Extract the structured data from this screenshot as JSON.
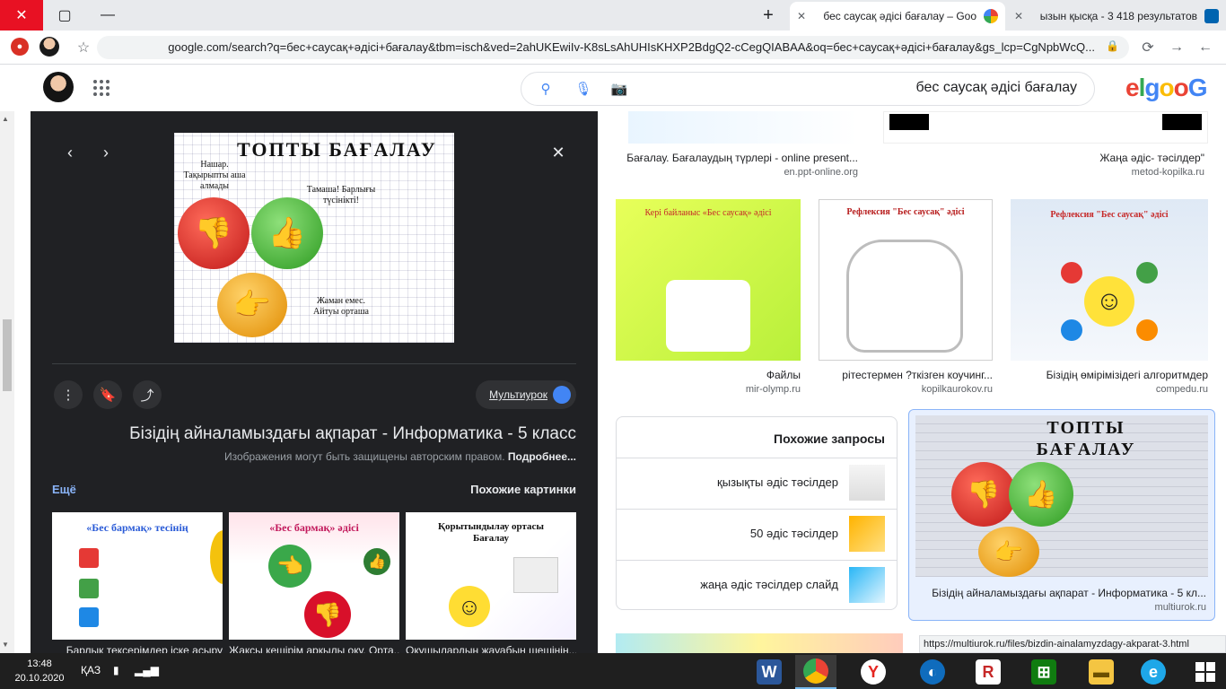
{
  "tabs": [
    {
      "title": "бес саусақ әдісі бағалау – Goo",
      "active": true
    },
    {
      "title": "ызын қысқа - 3 418 результатов",
      "active": false
    }
  ],
  "window_controls": {
    "close": "✕",
    "maximize": "▢",
    "minimize": "—"
  },
  "address_bar": {
    "url": "google.com/search?q=бес+саусақ+әдісі+бағалау&tbm=isch&ved=2ahUKEwiIv-K8sLsAhUHIsKHXP2BdgQ2-cCegQIABAA&oq=бес+саусақ+әдісі+бағалау&gs_lcp=CgNpbWcQ..."
  },
  "search": {
    "query": "бес саусақ әдісі бағалау"
  },
  "logo": {
    "letters": [
      "G",
      "o",
      "o",
      "g",
      "l",
      "e"
    ],
    "colors": [
      "#4285f4",
      "#ea4335",
      "#fbbc05",
      "#4285f4",
      "#34a853",
      "#ea4335"
    ]
  },
  "preview": {
    "image_title": "ТОПТЫ БАҒАЛАУ",
    "image_labels": {
      "top_left": "Нашар. Тақырыпты аша алмады",
      "middle": "Тамаша! Барлығы түсінікті!",
      "bottom": "Жаман емес. Айтуы орташа"
    },
    "source": "Мультиурок",
    "title": "Бізідің айналамыздағы ақпарат - Информатика - 5 класс",
    "copyright": "Изображения могут быть защищены авторским правом.",
    "copyright_link": "Подробнее...",
    "similar_label": "Похожие картинки",
    "more_label": "Ещё",
    "similar": [
      {
        "caption": "Оқушылардың жауабын шешінін...",
        "img_title": "Қорытындылау ортасы Бағалау"
      },
      {
        "caption": "Жақсы кешірім арқылы оқу. Орта...",
        "img_title": "«Бес бармақ» әдісі"
      },
      {
        "caption": "Барлық тексерімдер іске асыру",
        "img_title": "«Бес бармақ» тесінің"
      }
    ]
  },
  "results": [
    {
      "title": "Бағалау. Бағалаудың түрлері - online present...",
      "source": "en.ppt-online.org"
    },
    {
      "title": "Жаңа әдіс- тәсілдер\"",
      "source": "metod-kopilka.ru"
    },
    {
      "title": "Файлы",
      "source": "mir-olymp.ru"
    },
    {
      "title": "рітестермен ?ткізген коучинг...",
      "source": "kopilkaurokov.ru"
    },
    {
      "title": "Бізідің өмірімізідегі алгоритмдер",
      "source": "compedu.ru"
    },
    {
      "title": "Бізідің айналамыздағы ақпарат - Информатика - 5 кл...",
      "source": "multiurok.ru"
    }
  ],
  "result_images": {
    "file_title": "Кері байланыс «Бес саусақ» әдісі",
    "hand_title": "Рефлексия \"Бес саусақ\" әдісі",
    "sun_title": "Рефлексия \"Бес саусақ\" әдісі"
  },
  "related": {
    "heading": "Похожие запросы",
    "items": [
      "қызықты әдіс тәсілдер",
      "50 әдіс тәсілдер",
      "жаңа әдіс тәсілдер слайд"
    ]
  },
  "status_url": "https://multiurok.ru/files/bizdin-ainalamyzdagy-akparat-3.html",
  "taskbar": {
    "time": "13:48",
    "date": "20.10.2020",
    "lang": "ҚАЗ"
  },
  "colors": {
    "panel": "#202124",
    "accent_link": "#8ab4f8",
    "chrome_close": "#e81123",
    "taskbar": "#1f1f1f"
  }
}
